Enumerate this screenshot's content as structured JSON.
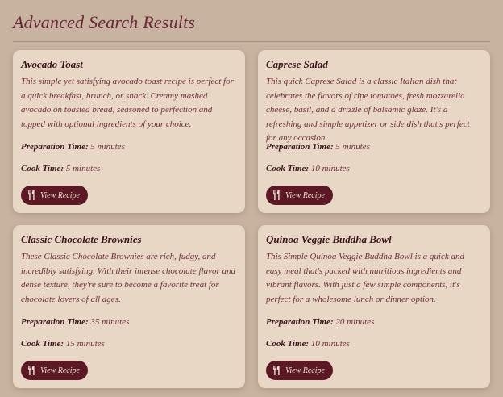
{
  "page": {
    "title": "Advanced Search Results"
  },
  "colors": {
    "background": "#c8b3a0",
    "card": "#e8d7c4",
    "accent": "#5b1926",
    "title": "#6b2737"
  },
  "labels": {
    "prep_time": "Preparation Time:",
    "cook_time": "Cook Time:",
    "view_recipe": "View Recipe",
    "view_icon": "utensils-icon"
  },
  "recipes": [
    {
      "title": "Avocado Toast",
      "description": "This simple yet satisfying avocado toast recipe is perfect for a quick breakfast, brunch, or snack. Creamy mashed avocado on toasted bread, seasoned to perfection and topped with optional ingredients of your choice.",
      "prep_time": "5 minutes",
      "cook_time": "5 minutes"
    },
    {
      "title": "Caprese Salad",
      "description": "This quick Caprese Salad is a classic Italian dish that celebrates the flavors of ripe tomatoes, fresh mozzarella cheese, basil, and a drizzle of balsamic glaze. It's a refreshing and simple appetizer or side dish that's perfect for any occasion.",
      "prep_time": "5 minutes",
      "cook_time": "10 minutes"
    },
    {
      "title": "Classic Chocolate Brownies",
      "description": "These Classic Chocolate Brownies are rich, fudgy, and incredibly satisfying. With their intense chocolate flavor and dense texture, they're sure to become a favorite treat for chocolate lovers of all ages.",
      "prep_time": "35 minutes",
      "cook_time": "15 minutes"
    },
    {
      "title": "Quinoa Veggie Buddha Bowl",
      "description": "This Simple Quinoa Veggie Buddha Bowl is a quick and easy meal that's packed with nutritious ingredients and vibrant flavors. With just a few simple components, it's perfect for a wholesome lunch or dinner option.",
      "prep_time": "20 minutes",
      "cook_time": "10 minutes"
    }
  ]
}
